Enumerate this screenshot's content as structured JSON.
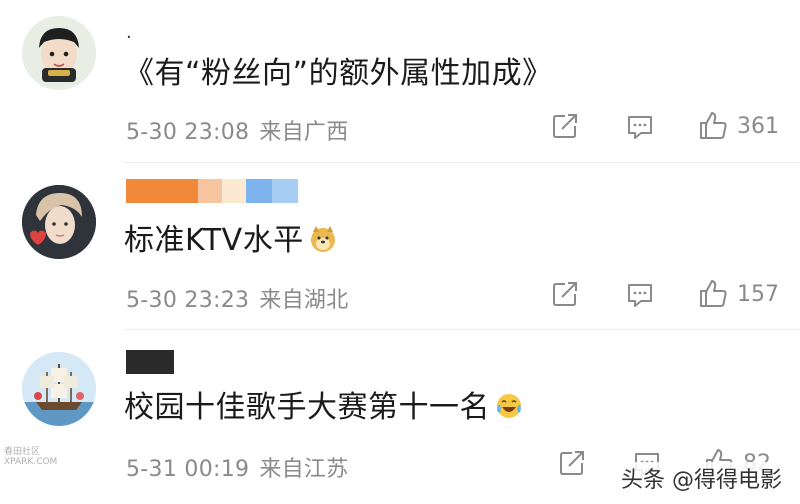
{
  "comments": [
    {
      "username_mark": ".",
      "text": "《有“粉丝向”的额外属性加成》",
      "time": "5-30 23:08",
      "source": "来自广西",
      "likes": "361"
    },
    {
      "text": "标准KTV水平",
      "time": "5-30 23:23",
      "source": "来自湖北",
      "likes": "157"
    },
    {
      "text": "校园十佳歌手大赛第十一名",
      "time": "5-31 00:19",
      "source": "来自江苏",
      "likes": "82"
    }
  ],
  "footer": {
    "brand": "头条 @得得电影",
    "watermark_line1": "春田社区",
    "watermark_line2": "XPARK.COM"
  },
  "colors": {
    "name_bar": [
      "#f08a3a",
      "#f7c4a0",
      "#fbe9d2",
      "#7fb3ee",
      "#a8cdf5"
    ],
    "icon_gray": "#8a8a8a"
  },
  "icons": [
    "share-icon",
    "comment-icon",
    "like-icon",
    "doge-emoji",
    "laugh-cry-emoji"
  ]
}
